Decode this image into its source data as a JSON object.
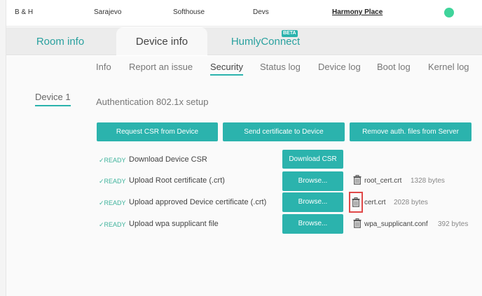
{
  "breadcrumbs": [
    {
      "label": "B & H"
    },
    {
      "label": "Sarajevo"
    },
    {
      "label": "Softhouse"
    },
    {
      "label": "Devs"
    },
    {
      "label": "Harmony Place"
    }
  ],
  "status": {
    "color": "#3fd49b"
  },
  "tabs": [
    {
      "label": "Room info"
    },
    {
      "label": "Device info"
    },
    {
      "label": "HumlyConnect",
      "badge": "BETA"
    }
  ],
  "subtabs": [
    {
      "label": "Info"
    },
    {
      "label": "Report an issue"
    },
    {
      "label": "Security"
    },
    {
      "label": "Status log"
    },
    {
      "label": "Device log"
    },
    {
      "label": "Boot log"
    },
    {
      "label": "Kernel log"
    }
  ],
  "device": {
    "label": "Device 1"
  },
  "section": {
    "title": "Authentication 802.1x setup"
  },
  "actions": {
    "request_csr": "Request CSR from Device",
    "send_cert": "Send certificate to Device",
    "remove_files": "Remove auth. files from Server"
  },
  "rows": [
    {
      "status": "✓READY",
      "label": "Download Device CSR",
      "button": "Download CSR"
    },
    {
      "status": "✓READY",
      "label": "Upload Root certificate (.crt)",
      "button": "Browse...",
      "file": "root_cert.crt",
      "size": "1328 bytes"
    },
    {
      "status": "✓READY",
      "label": "Upload approved Device certificate (.crt)",
      "button": "Browse...",
      "file": "cert.crt",
      "size": "2028 bytes"
    },
    {
      "status": "✓READY",
      "label": "Upload wpa supplicant file",
      "button": "Browse...",
      "file": "wpa_supplicant.conf",
      "size": "392 bytes"
    }
  ],
  "colors": {
    "accent": "#2bb3ad",
    "ready": "#3fb39c",
    "highlight": "#e04848"
  },
  "icons": {
    "delete": "trash-icon",
    "ready": "check-icon"
  }
}
